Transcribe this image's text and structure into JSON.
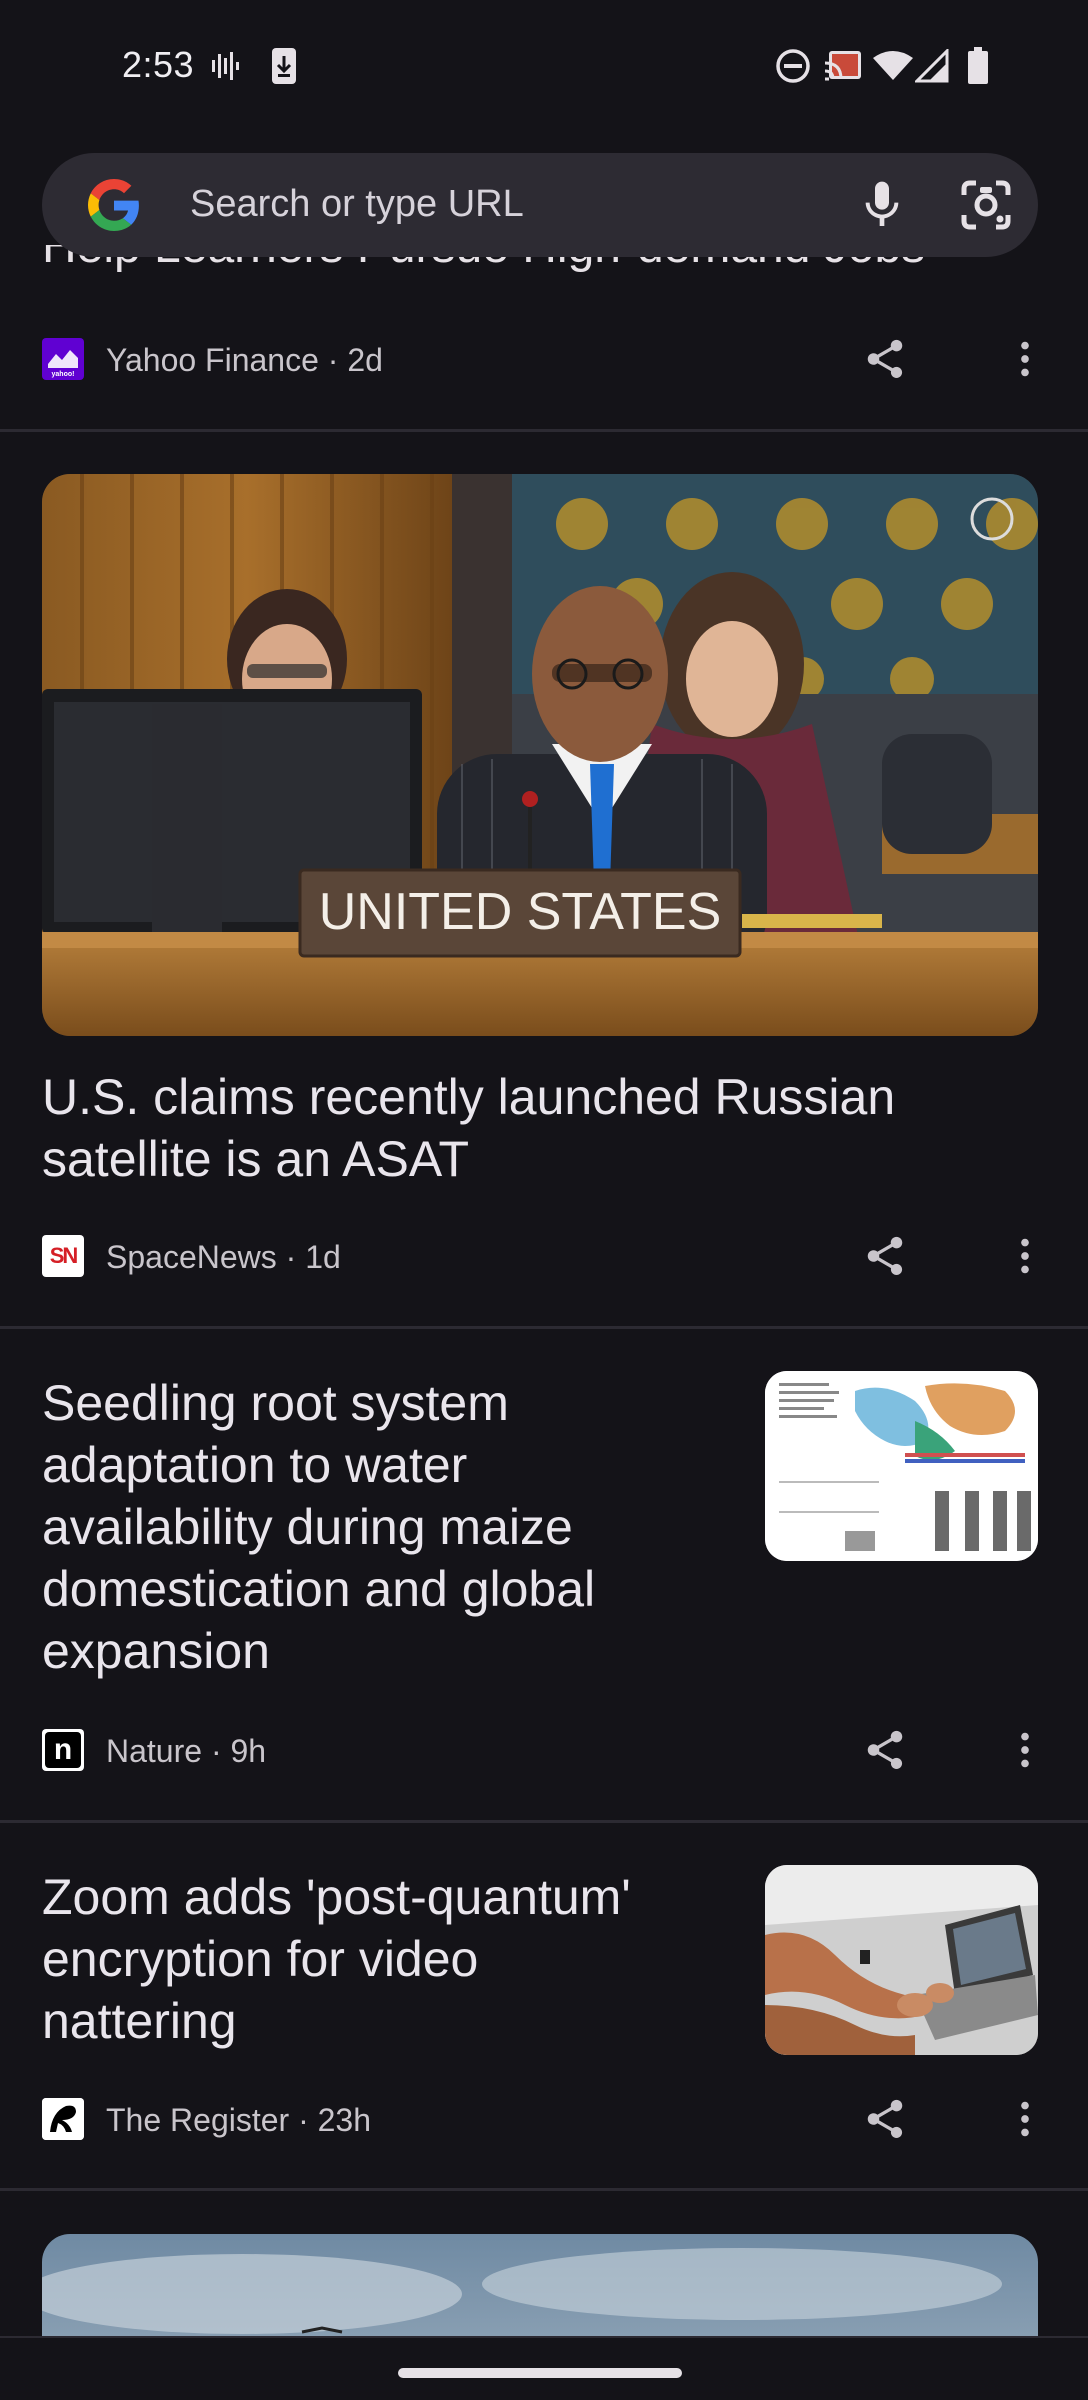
{
  "status_bar": {
    "time": "2:53",
    "icons": [
      "voicemail-bars-icon",
      "download-phone-icon",
      "do-not-disturb-icon",
      "cast-icon",
      "wifi-icon",
      "cell-signal-icon",
      "battery-icon"
    ]
  },
  "search": {
    "placeholder": "Search or type URL",
    "left_icon": "google-g-icon",
    "right_icons": [
      "microphone-icon",
      "google-lens-icon"
    ]
  },
  "feed": {
    "partial_article": {
      "title_fragment": "Help Learners Pursue High-demand Jobs",
      "source": "Yahoo Finance",
      "age": "2d",
      "logo_text": "yahoo!"
    },
    "articles": [
      {
        "title_line1": "U.S. claims recently launched Russian",
        "title_line2": "satellite is an ASAT",
        "source": "SpaceNews",
        "age": "1d",
        "logo_text": "SN",
        "image_text": "UNITED  STATES"
      },
      {
        "title_line1": "Seedling root system",
        "title_line2": "adaptation to water",
        "title_line3": "availability during maize",
        "title_line4": "domestication and global",
        "title_line5": "expansion",
        "source": "Nature",
        "age": "9h",
        "logo_text": "n"
      },
      {
        "title_line1": "Zoom adds 'post-quantum'",
        "title_line2": "encryption for video",
        "title_line3": "nattering",
        "source": "The Register",
        "age": "23h"
      }
    ],
    "separator": " · "
  },
  "colors": {
    "background": "#141318",
    "search_bar": "#2d2b33",
    "text_primary": "#e9e5ec",
    "text_secondary": "#c9c5cb",
    "divider": "#2c2a32"
  }
}
